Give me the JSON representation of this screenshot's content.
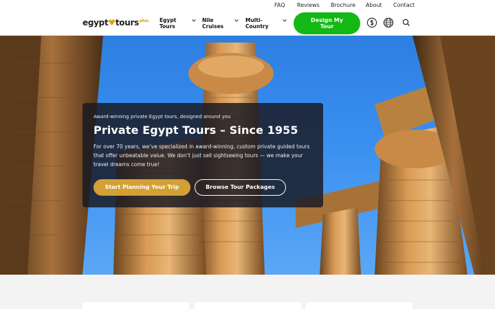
{
  "topbar": {
    "links": [
      "FAQ",
      "Reviews",
      "Brochure",
      "About",
      "Contact"
    ]
  },
  "logo": {
    "part1": "egypt",
    "pin": "♥",
    "part2": "tours",
    "plus": "plus"
  },
  "nav": {
    "items": [
      {
        "line1": "Egypt",
        "line2": "Tours"
      },
      {
        "line1": "Nile",
        "line2": "Cruises"
      },
      {
        "line1": "Multi-",
        "line2": "Country"
      }
    ],
    "cta_line1": "Design My",
    "cta_line2": "Tour",
    "icons": [
      "currency-icon",
      "globe-icon",
      "search-icon"
    ]
  },
  "hero": {
    "kicker": "Award-winning private Egypt tours, designed around you",
    "title": "Private Egypt Tours – Since 1955",
    "body": "For over 70 years, we’ve specialized in award-winning, custom private guided tours that offer unbeatable value. We don’t just sell sightseeing tours — we make your travel dreams come true!",
    "primary_button": "Start Planning Your Trip",
    "secondary_button": "Browse Tour Packages"
  },
  "colors": {
    "cta_green": "#14b814",
    "gold": "#d3a036",
    "sky": "#3a8ff0"
  }
}
